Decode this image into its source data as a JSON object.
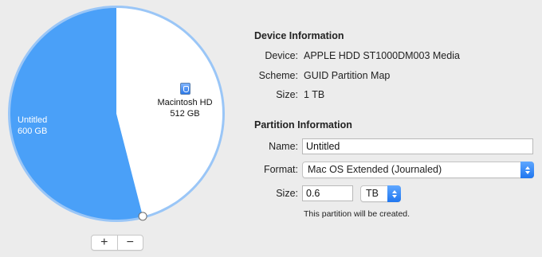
{
  "pie": {
    "slices": [
      {
        "name": "Untitled",
        "size": "600 GB",
        "fraction": 0.54,
        "color": "#4aa0f8"
      },
      {
        "name": "Macintosh HD",
        "size": "512 GB",
        "fraction": 0.46,
        "color": "#ffffff"
      }
    ],
    "ring_color": "#9ac6f7"
  },
  "buttons": {
    "add": "+",
    "remove": "−"
  },
  "device_info": {
    "title": "Device Information",
    "device_label": "Device:",
    "device_value": "APPLE HDD ST1000DM003 Media",
    "scheme_label": "Scheme:",
    "scheme_value": "GUID Partition Map",
    "size_label": "Size:",
    "size_value": "1 TB"
  },
  "partition_info": {
    "title": "Partition Information",
    "name_label": "Name:",
    "name_value": "Untitled",
    "format_label": "Format:",
    "format_value": "Mac OS Extended (Journaled)",
    "size_label": "Size:",
    "size_value": "0.6",
    "size_unit": "TB",
    "note": "This partition will be created."
  }
}
